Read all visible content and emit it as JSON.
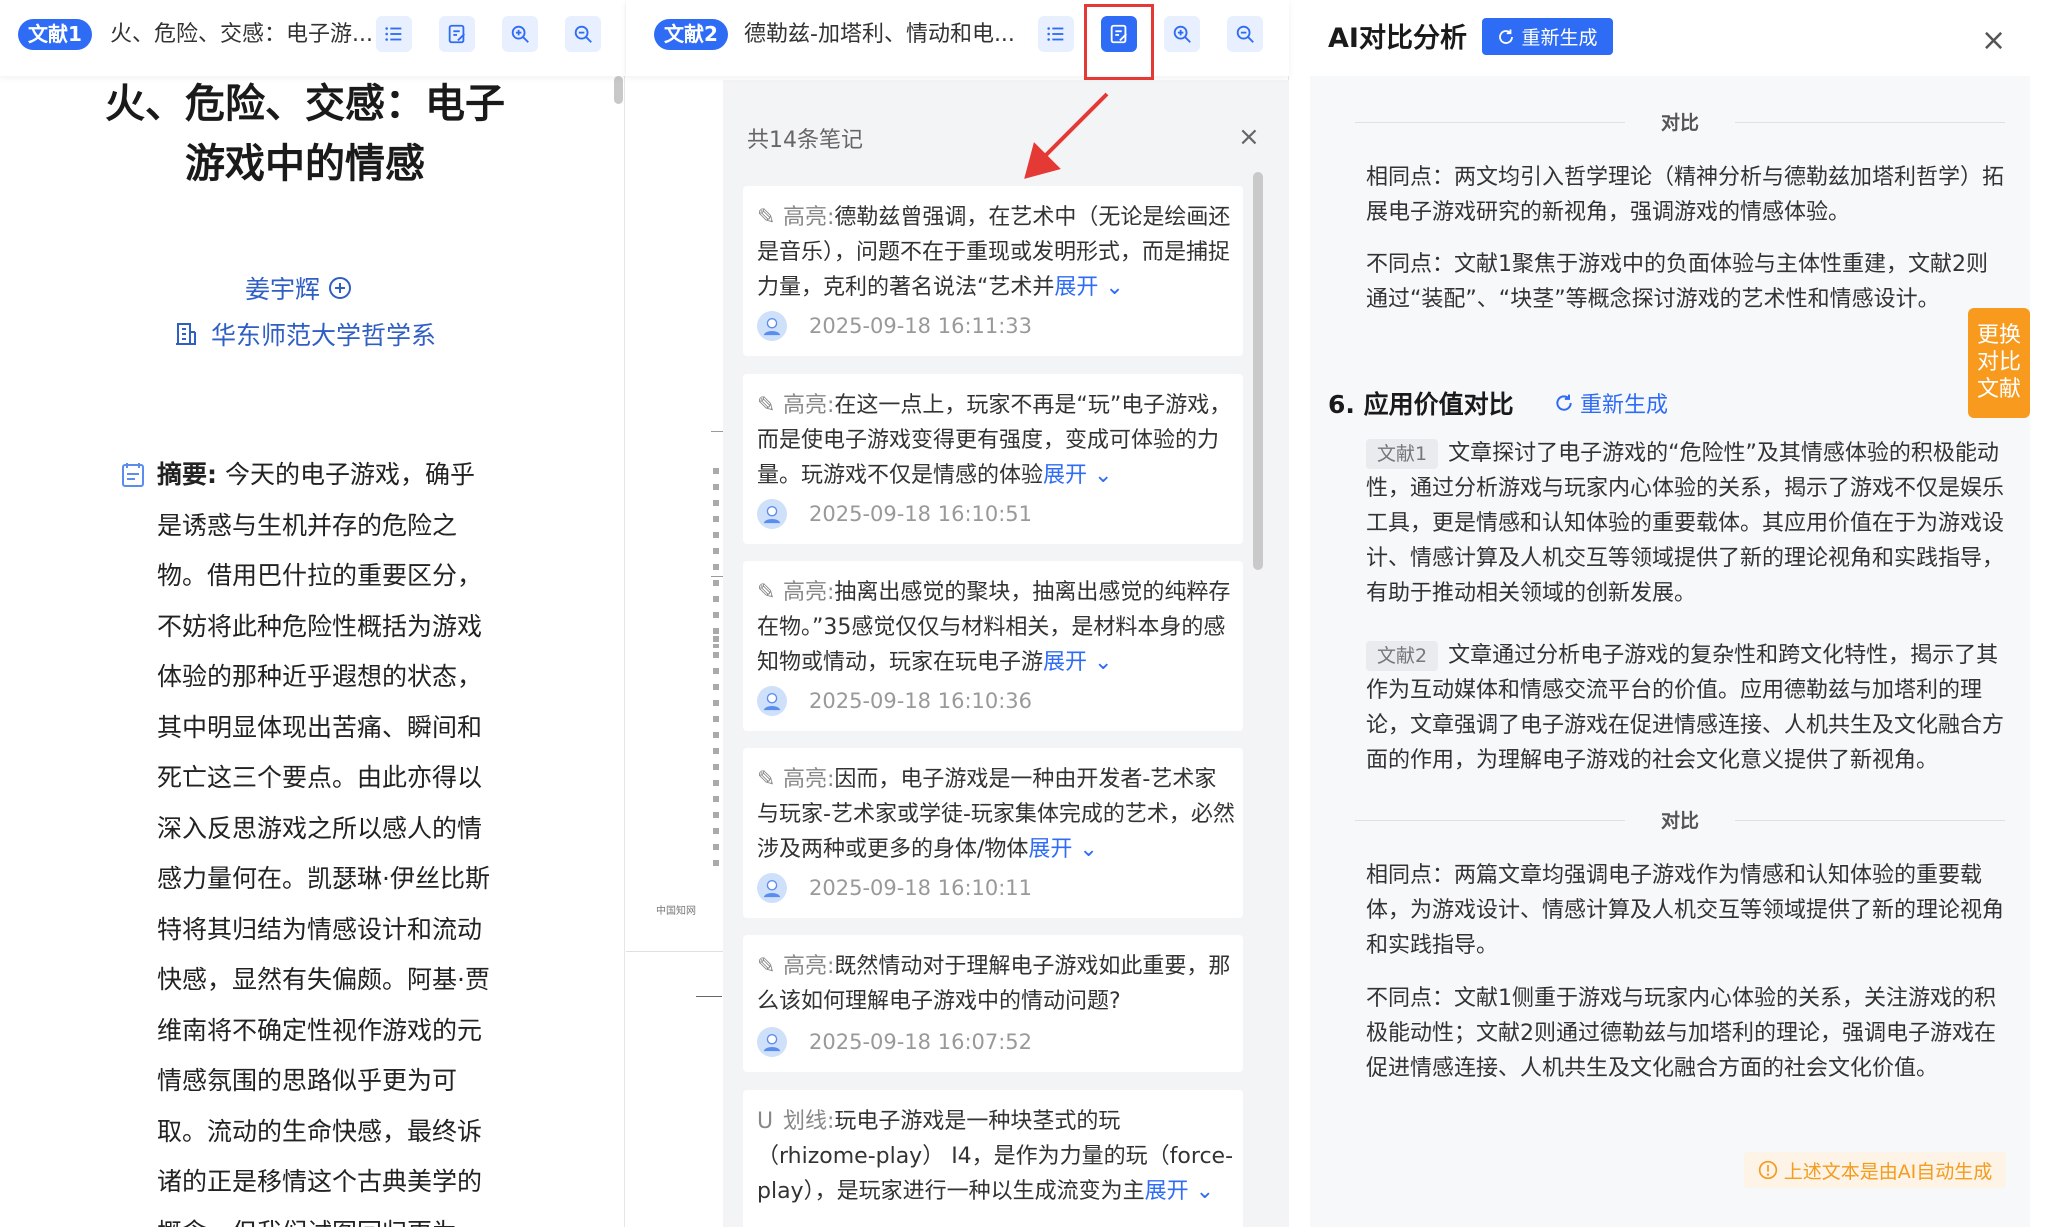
{
  "doc1": {
    "tag": "文献1",
    "title": "火、危险、交感：电子游...",
    "paper_title": "火、危险、交感：电子游戏中的情感",
    "author": "姜宇辉",
    "affiliation": "华东师范大学哲学系",
    "abstract_label": "摘要:",
    "abstract_text": " 今天的电子游戏，确乎是诱惑与生机并存的危险之物。借用巴什拉的重要区分，不妨将此种危险性概括为游戏体验的那种近乎遐想的状态，其中明显体现出苦痛、瞬间和死亡这三个要点。由此亦得以深入反思游戏之所以感人的情感力量何在。凯瑟琳·伊丝比斯特将其归结为情感设计和流动快感，显然有失偏颇。阿基·贾维南将不确定性视作游戏的元情感氛围的思路似乎更为可取。流动的生命快感，最终诉诸的正是移情这个古典美学的概念，但我们试图回归更为"
  },
  "doc2": {
    "tag": "文献2",
    "title": "德勒兹-加塔利、情动和电...",
    "underlay_source": "中国知网"
  },
  "notes": {
    "count_label": "共14条笔记",
    "close": "×",
    "items": [
      {
        "type": "高亮:",
        "text": "德勒兹曾强调，在艺术中（无论是绘画还是音乐），问题不在于重现或发明形式，而是捕捉力量，克利的著名说法“艺术并",
        "more": "展开",
        "time": "2025-09-18 16:11:33"
      },
      {
        "type": "高亮:",
        "text": "在这一点上，玩家不再是“玩”电子游戏，而是使电子游戏变得更有强度，变成可体验的力量。玩游戏不仅是情感的体验",
        "more": "展开",
        "time": "2025-09-18 16:10:51"
      },
      {
        "type": "高亮:",
        "text": "抽离出感觉的聚块，抽离出感觉的纯粹存在物。”35感觉仅仅与材料相关，是材料本身的感知物或情动，玩家在玩电子游",
        "more": "展开",
        "time": "2025-09-18 16:10:36"
      },
      {
        "type": "高亮:",
        "text": "因而，电子游戏是一种由开发者-艺术家与玩家-艺术家或学徒-玩家集体完成的艺术，必然涉及两种或更多的身体/物体",
        "more": "展开",
        "time": "2025-09-18 16:10:11"
      },
      {
        "type": "高亮:",
        "text": "既然情动对于理解电子游戏如此重要，那么该如何理解电子游戏中的情动问题?",
        "more": "",
        "time": "2025-09-18 16:07:52"
      },
      {
        "type": "划线:",
        "text": "玩电子游戏是一种块茎式的玩（rhizome-play） I4，是作为力量的玩（force-play），是玩家进行一种以生成流变为主",
        "more": "展开",
        "time": ""
      }
    ]
  },
  "ai": {
    "title": "AI对比分析",
    "regen_label": "重新生成",
    "close": "×",
    "compare_label": "对比",
    "block1_same": "相同点：两文均引入哲学理论（精神分析与德勒兹加塔利哲学）拓展电子游戏研究的新视角，强调游戏的情感体验。",
    "block1_diff": "不同点：文献1聚焦于游戏中的负面体验与主体性重建，文献2则通过“装配”、“块茎”等概念探讨游戏的艺术性和情感设计。",
    "section_title": "6. 应用价值对比",
    "section_regen": "重新生成",
    "cite1": "文献1",
    "cite1_text": "文章探讨了电子游戏的“危险性”及其情感体验的积极能动性，通过分析游戏与玩家内心体验的关系，揭示了游戏不仅是娱乐工具，更是情感和认知体验的重要载体。其应用价值在于为游戏设计、情感计算及人机交互等领域提供了新的理论视角和实践指导，有助于推动相关领域的创新发展。",
    "cite2": "文献2",
    "cite2_text": "文章通过分析电子游戏的复杂性和跨文化特性，揭示了其作为互动媒体和情感交流平台的价值。应用德勒兹与加塔利的理论，文章强调了电子游戏在促进情感连接、人机共生及文化融合方面的作用，为理解电子游戏的社会文化意义提供了新视角。",
    "compare_label2": "对比",
    "block2_same": "相同点：两篇文章均强调电子游戏作为情感和认知体验的重要载体，为游戏设计、情感计算及人机交互等领域提供了新的理论视角和实践指导。",
    "block2_diff": "不同点：文献1侧重于游戏与玩家内心体验的关系，关注游戏的积极能动性；文献2则通过德勒兹与加塔利的理论，强调电子游戏在促进情感连接、人机共生及文化融合方面的社会文化价值。",
    "swap_label": "更换对比文献",
    "ai_notice": "上述文本是由AI自动生成"
  },
  "colors": {
    "accent": "#2f6cf6",
    "highlight_border": "#e53935",
    "swap": "#f79a1e"
  },
  "icons": [
    "list-icon",
    "note-icon",
    "zoom-in-icon",
    "zoom-out-icon",
    "close-icon",
    "refresh-icon",
    "pen-icon",
    "underline-icon",
    "avatar-icon",
    "add-circle-icon",
    "building-icon",
    "document-icon",
    "warning-icon",
    "chevron-down-icon"
  ]
}
